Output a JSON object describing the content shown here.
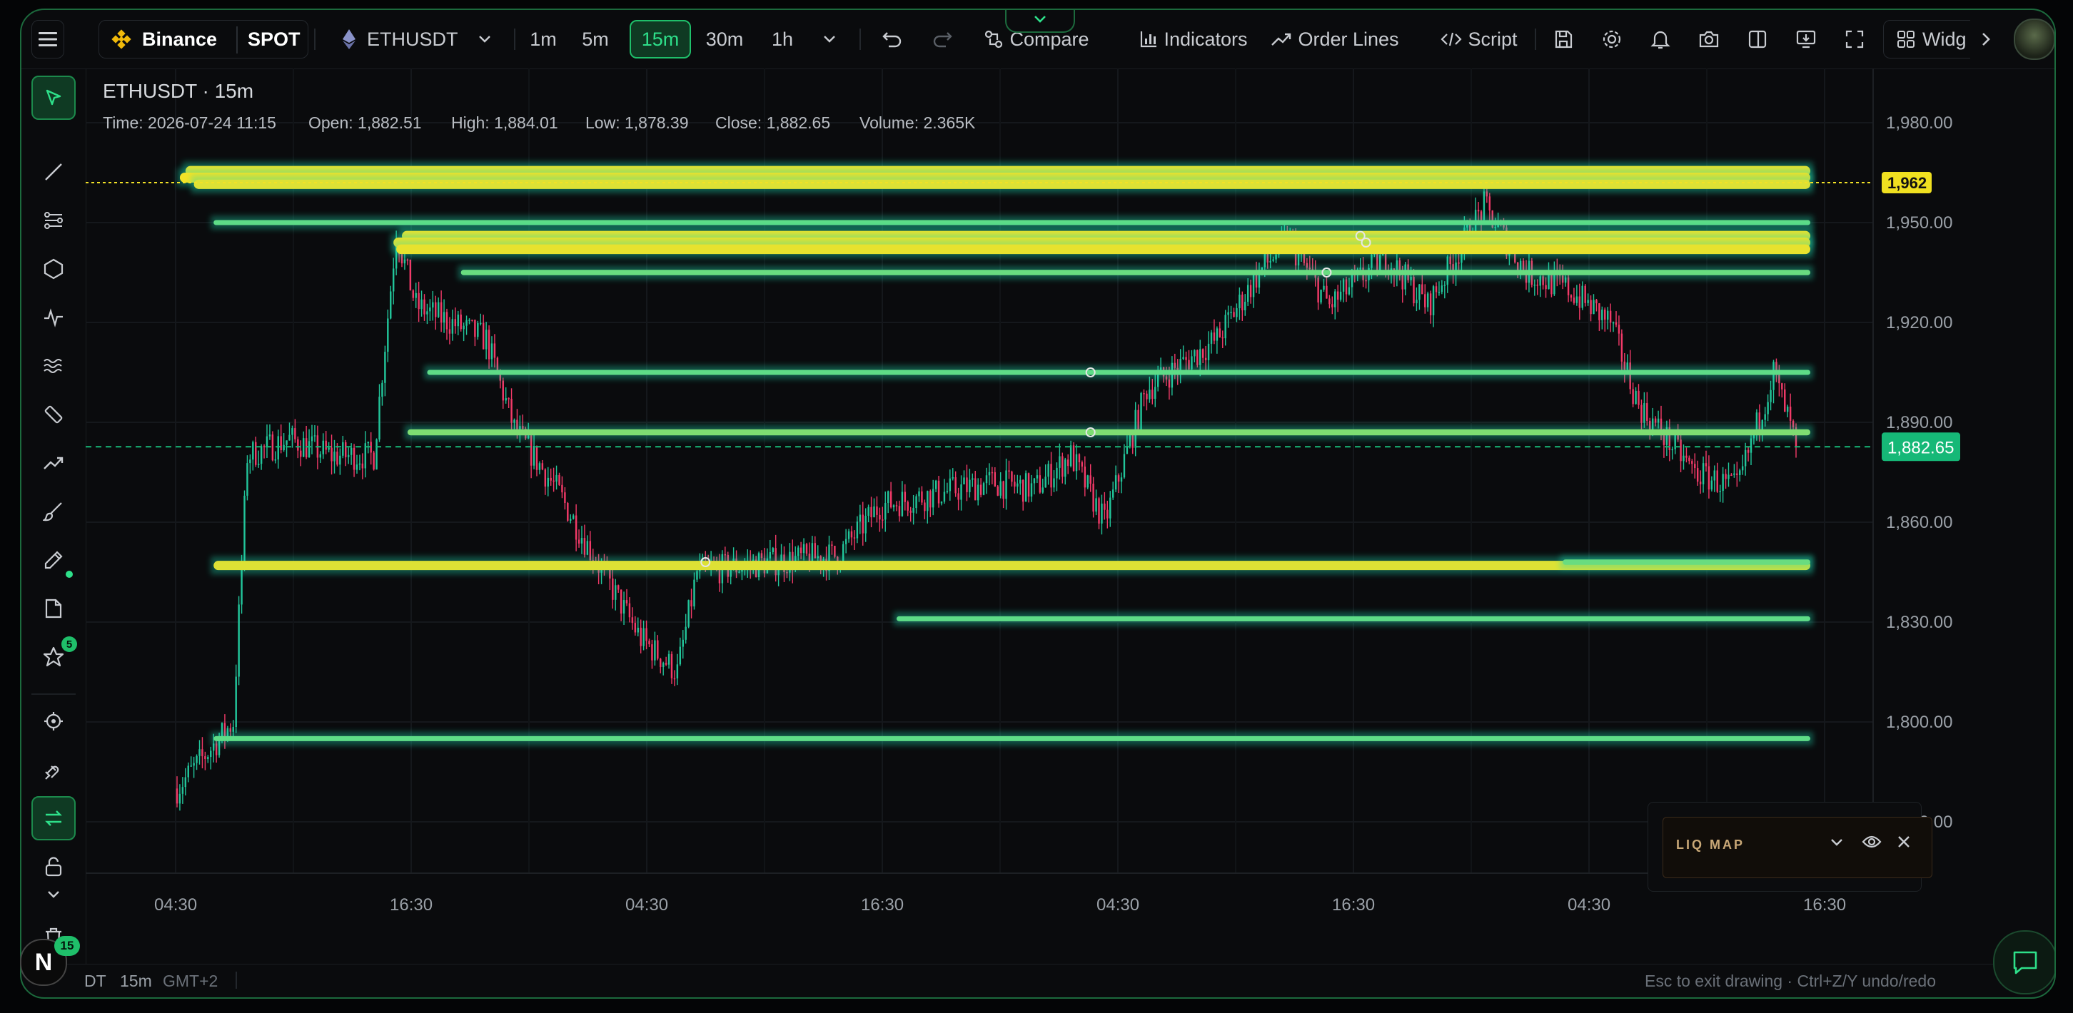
{
  "toolbar": {
    "exchange": "Binance",
    "market": "SPOT",
    "symbol": "ETHUSDT",
    "timeframes": [
      "1m",
      "5m",
      "15m",
      "30m",
      "1h"
    ],
    "active_timeframe": "15m",
    "compare": "Compare",
    "indicators": "Indicators",
    "order_lines": "Order Lines",
    "script": "Script",
    "widgets": "Widg",
    "collapse_icon": "chevron-down-icon"
  },
  "legend": {
    "title": "ETHUSDT · 15m",
    "time": "Time: 2026-07-24 11:15",
    "open": "Open: 1,882.51",
    "high": "High: 1,884.01",
    "low": "Low: 1,878.39",
    "close": "Close: 1,882.65",
    "volume": "Volume: 2.365K"
  },
  "price_axis": [
    "1,980.00",
    "1,950.00",
    "1,920.00",
    "1,890.00",
    "1,860.00",
    "1,830.00",
    "1,800.00",
    "1,770.00"
  ],
  "badges": {
    "alert_price": "1,962",
    "last_price": "1,882.65",
    "alert_color": "#f0e020",
    "last_color": "#16b877"
  },
  "time_axis": [
    "04:30",
    "16:30",
    "04:30",
    "16:30",
    "04:30",
    "16:30",
    "04:30",
    "16:30"
  ],
  "chart_data": {
    "type": "candlestick",
    "symbol": "ETHUSDT",
    "interval": "15m",
    "ylim": [
      1760,
      1990
    ],
    "price_key_points": [
      {
        "i": 0,
        "p": 1780
      },
      {
        "i": 15,
        "p": 1795
      },
      {
        "i": 20,
        "p": 1800
      },
      {
        "i": 25,
        "p": 1880
      },
      {
        "i": 40,
        "p": 1885
      },
      {
        "i": 55,
        "p": 1880
      },
      {
        "i": 70,
        "p": 1880
      },
      {
        "i": 78,
        "p": 1947
      },
      {
        "i": 85,
        "p": 1925
      },
      {
        "i": 110,
        "p": 1915
      },
      {
        "i": 120,
        "p": 1888
      },
      {
        "i": 135,
        "p": 1870
      },
      {
        "i": 148,
        "p": 1850
      },
      {
        "i": 165,
        "p": 1825
      },
      {
        "i": 178,
        "p": 1815
      },
      {
        "i": 185,
        "p": 1845
      },
      {
        "i": 210,
        "p": 1848
      },
      {
        "i": 235,
        "p": 1850
      },
      {
        "i": 250,
        "p": 1865
      },
      {
        "i": 290,
        "p": 1872
      },
      {
        "i": 305,
        "p": 1870
      },
      {
        "i": 318,
        "p": 1880
      },
      {
        "i": 330,
        "p": 1860
      },
      {
        "i": 345,
        "p": 1900
      },
      {
        "i": 370,
        "p": 1915
      },
      {
        "i": 385,
        "p": 1935
      },
      {
        "i": 395,
        "p": 1945
      },
      {
        "i": 410,
        "p": 1925
      },
      {
        "i": 430,
        "p": 1940
      },
      {
        "i": 445,
        "p": 1925
      },
      {
        "i": 465,
        "p": 1955
      },
      {
        "i": 480,
        "p": 1935
      },
      {
        "i": 495,
        "p": 1930
      },
      {
        "i": 510,
        "p": 1920
      },
      {
        "i": 520,
        "p": 1895
      },
      {
        "i": 540,
        "p": 1875
      },
      {
        "i": 555,
        "p": 1870
      },
      {
        "i": 568,
        "p": 1905
      },
      {
        "i": 576,
        "p": 1883
      }
    ],
    "liquidation_levels": [
      {
        "price": 1965.5,
        "from_index": 3,
        "intensity": 1.0
      },
      {
        "price": 1963.5,
        "from_index": 1,
        "intensity": 1.0
      },
      {
        "price": 1961.5,
        "from_index": 6,
        "intensity": 0.9
      },
      {
        "price": 1950,
        "from_index": 13,
        "intensity": 0.3
      },
      {
        "price": 1946,
        "from_index": 80,
        "intensity": 1.0
      },
      {
        "price": 1944,
        "from_index": 77,
        "intensity": 1.0
      },
      {
        "price": 1942,
        "from_index": 78,
        "intensity": 0.95
      },
      {
        "price": 1935,
        "from_index": 101,
        "intensity": 0.35
      },
      {
        "price": 1905,
        "from_index": 89,
        "intensity": 0.3
      },
      {
        "price": 1887,
        "from_index": 82,
        "intensity": 0.45
      },
      {
        "price": 1847,
        "from_index": 13,
        "intensity": 0.9
      },
      {
        "price": 1848,
        "from_index": 493,
        "intensity": 0.35
      },
      {
        "price": 1831,
        "from_index": 256,
        "intensity": 0.3
      },
      {
        "price": 1795,
        "from_index": 13,
        "intensity": 0.3
      }
    ],
    "alert_line": 1962,
    "last_price": 1882.65,
    "up_color": "#22c59a",
    "down_color": "#f23a68",
    "liq_color": "#f2e227",
    "liq_glow": "#1fd9b0"
  },
  "liq_panel": {
    "label": "LIQ MAP"
  },
  "bottom": {
    "symbol_partial": "DT",
    "interval": "15m",
    "timezone": "GMT+2",
    "hint": "Esc to exit drawing · Ctrl+Z/Y undo/redo",
    "avatar_letter": "N",
    "avatar_badge": "15"
  },
  "leftbar": {
    "favorites_badge": "5"
  }
}
